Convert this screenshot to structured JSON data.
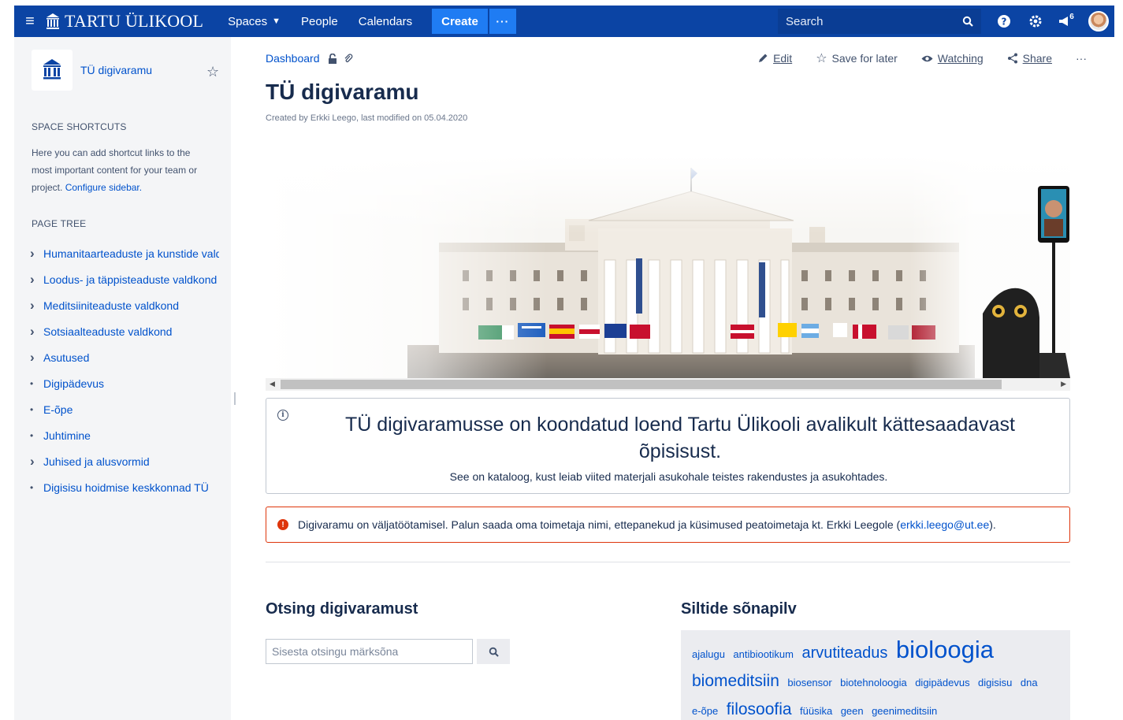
{
  "topbar": {
    "brand": "TARTU ÜLIKOOL",
    "nav": [
      "Spaces",
      "People",
      "Calendars"
    ],
    "create_label": "Create",
    "more_label": "···",
    "search_placeholder": "Search",
    "notifications_count": "6",
    "colors": {
      "bar": "#0b44a4",
      "create": "#1f7cf3"
    }
  },
  "sidebar": {
    "space_name": "TÜ digivaramu",
    "shortcuts_title": "SPACE SHORTCUTS",
    "shortcuts_text": "Here you can add shortcut links to the most important content for your team or project.",
    "configure_link": "Configure sidebar.",
    "tree_title": "PAGE TREE",
    "tree": [
      {
        "label": "Humanitaarteaduste ja kunstide valdkond",
        "expandable": true
      },
      {
        "label": "Loodus- ja täppisteaduste valdkond",
        "expandable": true
      },
      {
        "label": "Meditsiiniteaduste valdkond",
        "expandable": true
      },
      {
        "label": "Sotsiaalteaduste valdkond",
        "expandable": true
      },
      {
        "label": "Asutused",
        "expandable": true
      },
      {
        "label": "Digipädevus",
        "expandable": false
      },
      {
        "label": "E-õpe",
        "expandable": false
      },
      {
        "label": "Juhtimine",
        "expandable": false
      },
      {
        "label": "Juhised ja alusvormid",
        "expandable": true
      },
      {
        "label": "Digisisu hoidmise keskkonnad TÜ",
        "expandable": false
      }
    ]
  },
  "page": {
    "breadcrumb": "Dashboard",
    "actions": {
      "edit": "Edit",
      "save": "Save for later",
      "watching": "Watching",
      "share": "Share",
      "more": "···"
    },
    "title": "TÜ digivaramu",
    "byline": "Created by Erkki Leego, last modified on 05.04.2020",
    "info_title": "TÜ digivaramusse on koondatud loend Tartu Ülikooli avalikult kättesaadavast õpisisust.",
    "info_sub": "See on kataloog, kust leiab viited materjali asukohale teistes rakendustes ja asukohtades.",
    "warning_text": "Digivaramu on väljatöötamisel. Palun saada oma toimetaja nimi, ettepanekud ja küsimused peatoimetaja kt. Erkki Leegole (",
    "warning_email": "erkki.leego@ut.ee",
    "warning_end": ").",
    "search_heading": "Otsing digivaramust",
    "search_placeholder": "Sisesta otsingu märksõna",
    "cloud_heading": "Siltide sõnapilv",
    "tags": [
      {
        "label": "ajalugu",
        "size": 13
      },
      {
        "label": "antibiootikum",
        "size": 13
      },
      {
        "label": "arvutiteadus",
        "size": 20
      },
      {
        "label": "bioloogia",
        "size": 31
      },
      {
        "label": "biomeditsiin",
        "size": 21
      },
      {
        "label": "biosensor",
        "size": 13
      },
      {
        "label": "biotehnoloogia",
        "size": 13
      },
      {
        "label": "digipädevus",
        "size": 13
      },
      {
        "label": "digisisu",
        "size": 13
      },
      {
        "label": "dna",
        "size": 13
      },
      {
        "label": "e-õpe",
        "size": 13
      },
      {
        "label": "filosoofia",
        "size": 21
      },
      {
        "label": "füüsika",
        "size": 13
      },
      {
        "label": "geen",
        "size": 13
      },
      {
        "label": "geenimeditsiin",
        "size": 13
      }
    ]
  }
}
